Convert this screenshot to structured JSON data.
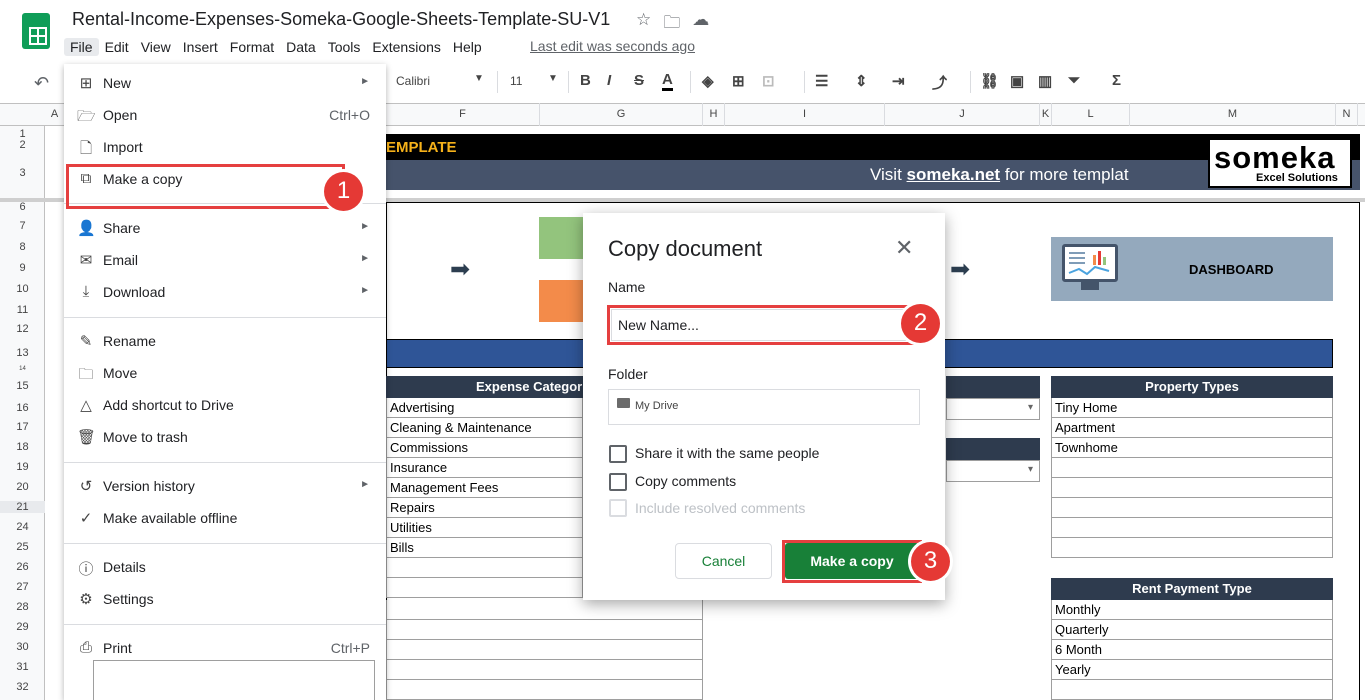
{
  "header": {
    "doc_title": "Rental-Income-Expenses-Someka-Google-Sheets-Template-SU-V1",
    "title_icons": [
      "star-icon",
      "move-folder-icon",
      "cloud-status-icon"
    ],
    "menu": [
      "File",
      "Edit",
      "View",
      "Insert",
      "Format",
      "Data",
      "Tools",
      "Extensions",
      "Help"
    ],
    "last_edit": "Last edit was seconds ago"
  },
  "toolbar": {
    "font_name": "Calibri",
    "font_size": "11"
  },
  "columns": [
    "A",
    "F",
    "G",
    "H",
    "I",
    "J",
    "K",
    "L",
    "M",
    "N"
  ],
  "rows": [
    "1",
    "2",
    "3",
    "6",
    "7",
    "8",
    "9",
    "10",
    "11",
    "12",
    "13",
    "14",
    "15",
    "16",
    "17",
    "18",
    "19",
    "20",
    "21",
    "24",
    "25",
    "26",
    "27",
    "28",
    "29",
    "30",
    "31",
    "32"
  ],
  "sheet": {
    "banner_title": "EMPLATE",
    "visit_prefix": "Visit ",
    "visit_link": "someka.net",
    "visit_suffix": " for more templat",
    "brand_word": "someka",
    "brand_sub": "Excel Solutions",
    "dashboard_label": "DASHBOARD",
    "expense_header": "Expense Categor",
    "expense_items": [
      "Advertising",
      "Cleaning & Maintenance",
      "Commissions",
      "Insurance",
      "Management Fees",
      "Repairs",
      "Utilities",
      "Bills"
    ],
    "property_header": "Property Types",
    "property_items": [
      "Tiny Home",
      "Apartment",
      "Townhome"
    ],
    "rent_header": "Rent Payment Type",
    "rent_items": [
      "Monthly",
      "Quarterly",
      "6 Month",
      "Yearly"
    ]
  },
  "file_menu": {
    "items": [
      {
        "label": "New",
        "icon": "plus-box-icon",
        "submenu": true
      },
      {
        "label": "Open",
        "icon": "folder-open-icon",
        "shortcut": "Ctrl+O"
      },
      {
        "label": "Import",
        "icon": "file-import-icon"
      },
      {
        "label": "Make a copy",
        "icon": "copy-icon"
      },
      {
        "label": "Share",
        "icon": "person-add-icon",
        "submenu": true
      },
      {
        "label": "Email",
        "icon": "mail-icon",
        "submenu": true
      },
      {
        "label": "Download",
        "icon": "download-icon",
        "submenu": true
      },
      {
        "label": "Rename",
        "icon": "rename-icon"
      },
      {
        "label": "Move",
        "icon": "move-icon"
      },
      {
        "label": "Add shortcut to Drive",
        "icon": "drive-shortcut-icon"
      },
      {
        "label": "Move to trash",
        "icon": "trash-icon"
      },
      {
        "label": "Version history",
        "icon": "history-icon",
        "submenu": true
      },
      {
        "label": "Make available offline",
        "icon": "offline-icon"
      },
      {
        "label": "Details",
        "icon": "info-icon"
      },
      {
        "label": "Settings",
        "icon": "gear-icon"
      },
      {
        "label": "Print",
        "icon": "print-icon",
        "shortcut": "Ctrl+P"
      }
    ]
  },
  "dialog": {
    "title": "Copy document",
    "name_label": "Name",
    "name_value": "New Name...",
    "folder_label": "Folder",
    "folder_value": "My Drive",
    "share_label": "Share it with the same people",
    "copy_comments_label": "Copy comments",
    "resolved_label": "Include resolved comments",
    "cancel": "Cancel",
    "confirm": "Make a copy"
  },
  "annotations": [
    "1",
    "2",
    "3"
  ],
  "colors": {
    "accent_green": "#188038",
    "highlight_red": "#e53f3f",
    "banner_gold": "#f6b21a",
    "table_header": "#2e3b4e"
  }
}
